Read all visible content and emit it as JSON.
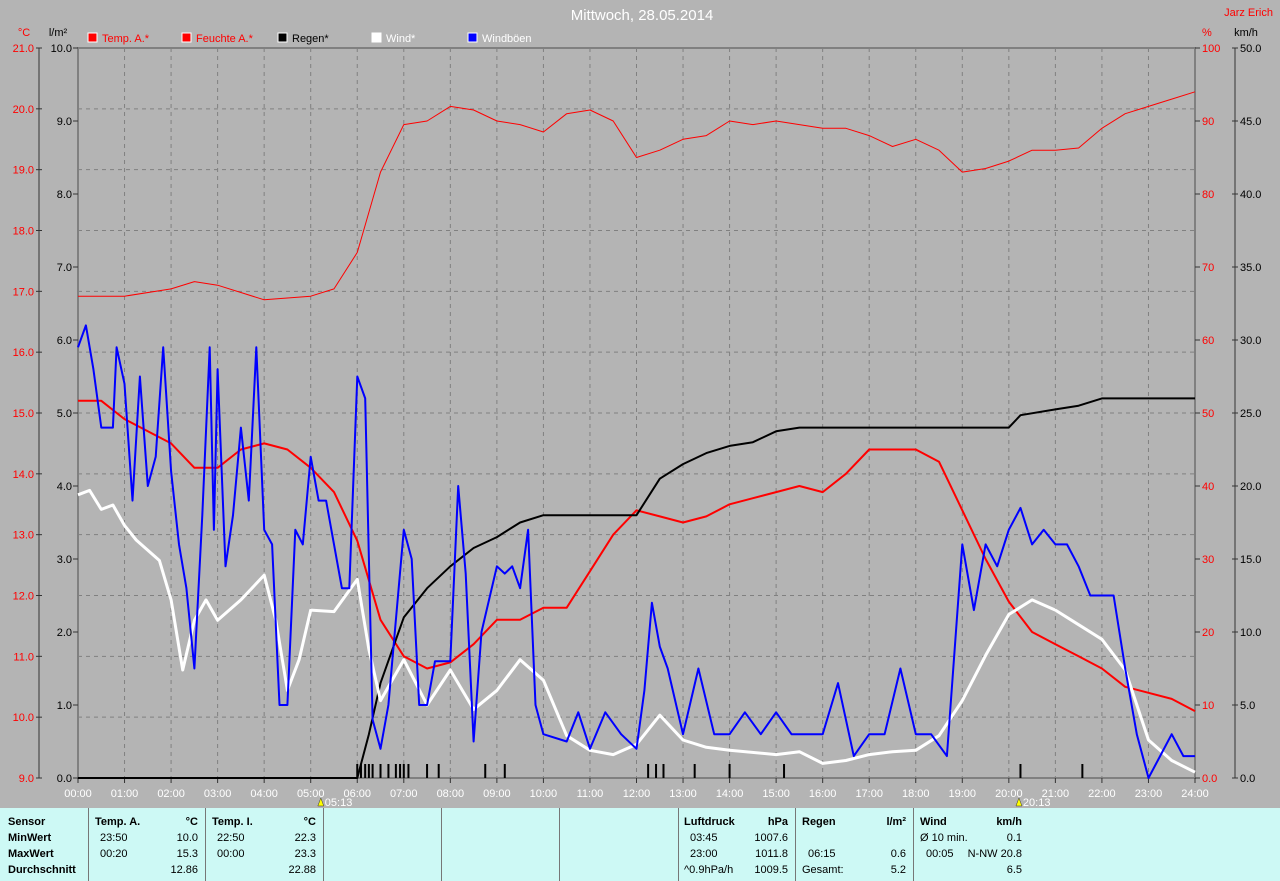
{
  "chart_data": {
    "type": "line",
    "title": "Mittwoch, 28.05.2014",
    "author": "Jarz Erich",
    "x_ticks": [
      "00:00",
      "01:00",
      "02:00",
      "03:00",
      "04:00",
      "05:00",
      "06:00",
      "07:00",
      "08:00",
      "09:00",
      "10:00",
      "11:00",
      "12:00",
      "13:00",
      "14:00",
      "15:00",
      "16:00",
      "17:00",
      "18:00",
      "19:00",
      "20:00",
      "21:00",
      "22:00",
      "23:00",
      "24:00"
    ],
    "xlim": [
      0,
      24
    ],
    "sunrise": "05:13",
    "sunset": "20:13",
    "sunrise_hour": 5.217,
    "sunset_hour": 20.217,
    "axes": {
      "temp": {
        "unit": "°C",
        "range": [
          9,
          21
        ],
        "ticks": [
          "9.0",
          "10.0",
          "11.0",
          "12.0",
          "13.0",
          "14.0",
          "15.0",
          "16.0",
          "17.0",
          "18.0",
          "19.0",
          "20.0",
          "21.0"
        ],
        "color": "#ff0000"
      },
      "rain": {
        "unit": "l/m²",
        "range": [
          0,
          10
        ],
        "ticks": [
          "0.0",
          "1.0",
          "2.0",
          "3.0",
          "4.0",
          "5.0",
          "6.0",
          "7.0",
          "8.0",
          "9.0",
          "10.0"
        ],
        "color": "#000000"
      },
      "humidity": {
        "unit": "%",
        "range": [
          0,
          100
        ],
        "ticks": [
          "0.0",
          "10",
          "20",
          "30",
          "40",
          "50",
          "60",
          "70",
          "80",
          "90",
          "100"
        ],
        "color": "#ff0000"
      },
      "wind": {
        "unit": "km/h",
        "range": [
          0,
          50
        ],
        "ticks": [
          "0.0",
          "5.0",
          "10.0",
          "15.0",
          "20.0",
          "25.0",
          "30.0",
          "35.0",
          "40.0",
          "45.0",
          "50.0"
        ],
        "color": "#000000"
      }
    },
    "grid": true,
    "legend": [
      {
        "name": "Temp. A.*",
        "color": "#ff0000",
        "text_color": "#ff0000"
      },
      {
        "name": "Feuchte A.*",
        "color": "#ff0000",
        "text_color": "#ff0000"
      },
      {
        "name": "Regen*",
        "color": "#000000",
        "text_color": "#000000"
      },
      {
        "name": "Wind*",
        "color": "#ffffff",
        "text_color": "#ffffff"
      },
      {
        "name": "Windböen",
        "color": "#0000ff",
        "text_color": "#ffffff"
      }
    ],
    "series": [
      {
        "name": "Temp. A.",
        "axis": "temp",
        "color": "#ff0000",
        "width": 2,
        "x": [
          0,
          0.5,
          1,
          1.5,
          2,
          2.5,
          3,
          3.5,
          4,
          4.5,
          5,
          5.5,
          6,
          6.5,
          7,
          7.5,
          8,
          8.5,
          9,
          9.5,
          10,
          10.5,
          11,
          11.5,
          12,
          12.5,
          13,
          13.5,
          14,
          14.5,
          15,
          15.5,
          16,
          16.5,
          17,
          17.5,
          18,
          18.5,
          19,
          19.5,
          20,
          20.5,
          21,
          21.5,
          22,
          22.5,
          23,
          23.5,
          24
        ],
        "y": [
          15.2,
          15.2,
          14.9,
          14.7,
          14.5,
          14.1,
          14.1,
          14.4,
          14.5,
          14.4,
          14.1,
          13.7,
          12.9,
          11.6,
          11.0,
          10.8,
          10.9,
          11.2,
          11.6,
          11.6,
          11.8,
          11.8,
          12.4,
          13.0,
          13.4,
          13.3,
          13.2,
          13.3,
          13.5,
          13.6,
          13.7,
          13.8,
          13.7,
          14.0,
          14.4,
          14.4,
          14.4,
          14.2,
          13.4,
          12.6,
          11.9,
          11.4,
          11.2,
          11.0,
          10.8,
          10.5,
          10.4,
          10.3,
          10.1
        ]
      },
      {
        "name": "Feuchte A.",
        "axis": "humidity",
        "color": "#ff0000",
        "width": 1,
        "x": [
          0,
          1,
          2,
          2.5,
          3,
          4,
          5,
          5.5,
          6,
          6.5,
          7,
          7.5,
          8,
          8.5,
          9,
          9.5,
          10,
          10.5,
          11,
          11.5,
          12,
          12.5,
          13,
          13.5,
          14,
          14.5,
          15,
          15.5,
          16,
          16.5,
          17,
          17.5,
          18,
          18.5,
          19,
          19.5,
          20,
          20.5,
          21,
          21.5,
          22,
          22.5,
          23,
          23.5,
          24
        ],
        "y": [
          66,
          66,
          67,
          68,
          67.5,
          65.5,
          66,
          67,
          72,
          83,
          89.5,
          90,
          92,
          91.5,
          90,
          89.5,
          88.5,
          91,
          91.5,
          90,
          85,
          86,
          87.5,
          88,
          90,
          89.5,
          90,
          89.5,
          89,
          89,
          88,
          86.5,
          87.5,
          86,
          83,
          83.5,
          84.5,
          86,
          86,
          86.3,
          89,
          91,
          92,
          93,
          94
        ]
      },
      {
        "name": "Regen",
        "axis": "rain",
        "color": "#000000",
        "width": 2,
        "x": [
          0,
          6.0,
          6.25,
          6.5,
          7,
          7.5,
          8,
          8.5,
          9,
          9.5,
          10,
          11,
          12,
          12.5,
          13,
          13.5,
          14,
          14.5,
          15,
          15.5,
          16,
          20,
          20.25,
          21,
          21.5,
          22,
          24
        ],
        "y": [
          0,
          0,
          0.6,
          1.3,
          2.2,
          2.6,
          2.9,
          3.15,
          3.3,
          3.5,
          3.6,
          3.6,
          3.6,
          4.1,
          4.3,
          4.45,
          4.55,
          4.6,
          4.75,
          4.8,
          4.8,
          4.8,
          4.97,
          5.05,
          5.1,
          5.2,
          5.2
        ]
      },
      {
        "name": "Wind",
        "axis": "wind",
        "color": "#ffffff",
        "width": 3,
        "x": [
          0,
          0.25,
          0.5,
          0.75,
          1,
          1.25,
          1.5,
          1.75,
          2,
          2.25,
          2.5,
          2.75,
          3,
          3.5,
          4,
          4.25,
          4.5,
          4.75,
          5,
          5.5,
          6,
          6.25,
          6.5,
          7,
          7.5,
          8,
          8.5,
          9,
          9.5,
          10,
          10.5,
          11,
          11.5,
          12,
          12.5,
          13,
          13.5,
          14,
          15,
          15.5,
          16,
          16.5,
          17,
          17.5,
          18,
          18.5,
          19,
          19.5,
          20,
          20.5,
          21,
          21.5,
          22,
          22.5,
          23,
          23.5,
          24
        ],
        "y": [
          19.4,
          19.7,
          18.4,
          18.7,
          17.3,
          16.3,
          15.6,
          14.9,
          12.2,
          7.4,
          10.8,
          12.2,
          10.8,
          12.2,
          13.9,
          10.8,
          6.0,
          8.1,
          11.5,
          11.4,
          13.6,
          8.8,
          5.3,
          8.1,
          5.0,
          7.4,
          4.7,
          6.0,
          8.1,
          6.7,
          2.9,
          1.9,
          1.6,
          2.3,
          4.3,
          2.6,
          2.1,
          1.9,
          1.6,
          1.8,
          1.0,
          1.2,
          1.6,
          1.8,
          1.9,
          2.9,
          5.3,
          8.4,
          11.2,
          12.2,
          11.5,
          10.5,
          9.5,
          7.4,
          2.6,
          1.2,
          0.4
        ]
      },
      {
        "name": "Windböen",
        "axis": "wind",
        "color": "#0000ff",
        "width": 2,
        "x": [
          0,
          0.17,
          0.33,
          0.5,
          0.75,
          0.83,
          1,
          1.17,
          1.33,
          1.5,
          1.67,
          1.83,
          2,
          2.17,
          2.33,
          2.5,
          2.67,
          2.83,
          2.92,
          3,
          3.17,
          3.33,
          3.5,
          3.67,
          3.83,
          4,
          4.17,
          4.33,
          4.5,
          4.67,
          4.83,
          5,
          5.17,
          5.33,
          5.5,
          5.67,
          5.83,
          6,
          6.17,
          6.33,
          6.5,
          6.67,
          7,
          7.17,
          7.33,
          7.5,
          7.67,
          8,
          8.17,
          8.33,
          8.5,
          8.67,
          9,
          9.17,
          9.33,
          9.5,
          9.67,
          9.83,
          10,
          10.5,
          10.75,
          11,
          11.33,
          11.67,
          12,
          12.17,
          12.33,
          12.5,
          12.67,
          13,
          13.33,
          13.67,
          14,
          14.33,
          14.67,
          15,
          15.33,
          15.67,
          16,
          16.33,
          16.67,
          17,
          17.33,
          17.67,
          18,
          18.33,
          18.67,
          19,
          19.25,
          19.5,
          19.75,
          20,
          20.25,
          20.5,
          20.75,
          21,
          21.25,
          21.5,
          21.75,
          22,
          22.25,
          22.5,
          22.75,
          23,
          23.25,
          23.5,
          23.75,
          24
        ],
        "y": [
          29.5,
          31,
          28,
          24,
          24,
          29.5,
          27,
          19,
          27.5,
          20,
          22,
          29.5,
          21,
          16,
          13,
          7.5,
          18,
          29.5,
          17,
          28,
          14.5,
          18,
          24,
          19,
          29.5,
          17,
          16,
          5,
          5,
          17,
          16,
          22,
          19,
          19,
          16,
          13,
          13,
          27.5,
          26,
          4,
          2,
          5,
          17,
          15,
          5,
          5,
          8,
          8,
          20,
          14,
          2.5,
          10,
          14.5,
          14,
          14.5,
          13,
          17,
          5,
          3,
          2.5,
          4.5,
          2,
          4.5,
          3,
          2,
          6,
          12,
          9,
          7.5,
          3,
          7.5,
          3,
          3,
          4.5,
          3,
          4.5,
          3,
          3,
          3,
          6.5,
          1.5,
          3,
          3,
          7.5,
          3,
          3,
          1.5,
          16,
          11.5,
          16,
          14.5,
          17,
          18.5,
          16,
          17,
          16,
          16,
          14.5,
          12.5,
          12.5,
          12.5,
          7.5,
          3,
          0,
          1.5,
          3,
          1.5,
          1.5
        ]
      }
    ],
    "rain_events": [
      6.0,
      6.08,
      6.17,
      6.25,
      6.33,
      6.5,
      6.67,
      6.83,
      6.92,
      7.0,
      7.1,
      7.5,
      7.75,
      8.75,
      9.17,
      12.25,
      12.42,
      12.58,
      13.25,
      14.0,
      15.17,
      20.25,
      21.58
    ]
  },
  "stats": {
    "sensor": {
      "header": "Sensor",
      "rows": [
        "MinWert",
        "MaxWert",
        "Durchschnitt"
      ]
    },
    "temp_a": {
      "header": "Temp. A.",
      "unit": "°C",
      "min_time": "23:50",
      "min": "10.0",
      "max_time": "00:20",
      "max": "15.3",
      "avg": "12.86"
    },
    "temp_i": {
      "header": "Temp. I.",
      "unit": "°C",
      "min_time": "22:50",
      "min": "22.3",
      "max_time": "00:00",
      "max": "23.3",
      "avg": "22.88"
    },
    "pressure": {
      "header": "Luftdruck",
      "unit": "hPa",
      "min_time": "03:45",
      "min": "1007.6",
      "max_time": "23:00",
      "max": "1011.8",
      "trend": "^0.9hPa/h",
      "avg": "1009.5"
    },
    "rain": {
      "header": "Regen",
      "unit": "l/m²",
      "max_time": "06:15",
      "max": "0.6",
      "total_label": "Gesamt:",
      "total": "5.2"
    },
    "wind": {
      "header": "Wind",
      "unit": "km/h",
      "avg_label": "Ø 10 min.",
      "avg10": "0.1",
      "max_time": "00:05",
      "max_dir": "N-NW 20.8",
      "avg": "6.5"
    }
  }
}
